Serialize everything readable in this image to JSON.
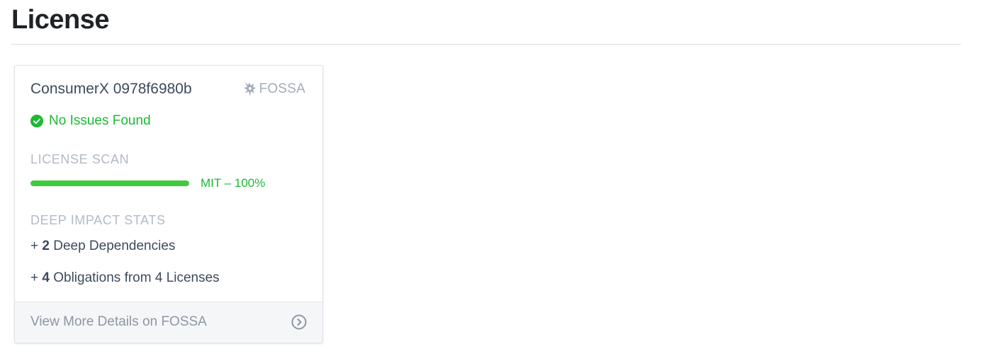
{
  "page": {
    "title": "License"
  },
  "card": {
    "project_name": "ConsumerX 0978f6980b",
    "brand": {
      "icon": "fossa-logo-icon",
      "wordmark": "FOSSA",
      "color": "#a3acb8"
    },
    "status": {
      "icon": "check-circle-icon",
      "text": "No Issues Found",
      "color": "#1bb934"
    },
    "license_scan": {
      "label": "LICENSE SCAN",
      "licenses": [
        {
          "name": "MIT",
          "percent": 100,
          "display": "MIT – 100%",
          "color": "#3ecb3a"
        }
      ]
    },
    "deep_impact": {
      "label": "DEEP IMPACT STATS",
      "stats": [
        {
          "prefix": "+ ",
          "value": "2",
          "text": " Deep Dependencies"
        },
        {
          "prefix": "+ ",
          "value": "4",
          "text": " Obligations from 4 Licenses"
        }
      ]
    },
    "footer": {
      "link_text": "View More Details on FOSSA",
      "icon": "chevron-right-circle-icon"
    }
  }
}
